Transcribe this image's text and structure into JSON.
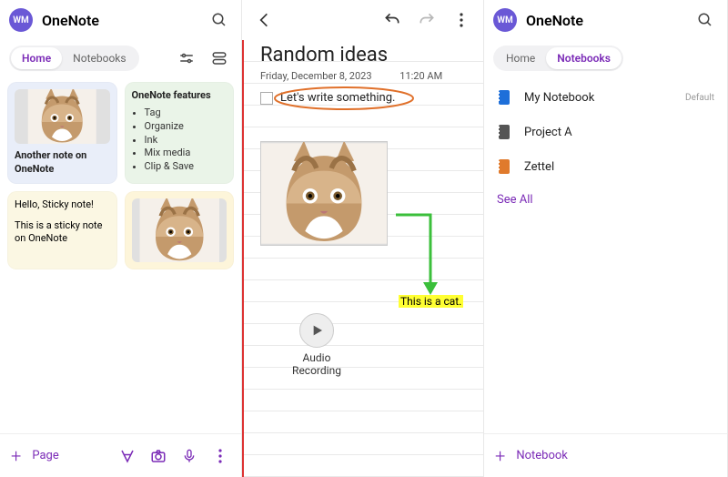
{
  "avatar_initials": "WM",
  "app_title": "OneNote",
  "col1": {
    "tabs": {
      "home": "Home",
      "notebooks": "Notebooks",
      "active": "home"
    },
    "cards": {
      "note1_title": "Another note on OneNote",
      "features_title": "OneNote features",
      "features": [
        "Tag",
        "Organize",
        "Ink",
        "Mix media",
        "Clip & Save"
      ],
      "sticky_line1": "Hello, Sticky note!",
      "sticky_line2": "This is a sticky note on OneNote"
    },
    "bottom": {
      "page": "Page"
    }
  },
  "col2": {
    "title": "Random ideas",
    "date": "Friday, December 8, 2023",
    "time": "11:20 AM",
    "todo_text": "Let's write something.",
    "caption": "This is a cat.",
    "audio_label": "Audio Recording"
  },
  "col3": {
    "tabs": {
      "home": "Home",
      "notebooks": "Notebooks",
      "active": "notebooks"
    },
    "items": [
      {
        "name": "My Notebook",
        "color": "#1e6fd9",
        "default": "Default"
      },
      {
        "name": "Project A",
        "color": "#555555"
      },
      {
        "name": "Zettel",
        "color": "#e07a2c"
      }
    ],
    "seeall": "See All",
    "bottom": {
      "notebook": "Notebook"
    }
  }
}
